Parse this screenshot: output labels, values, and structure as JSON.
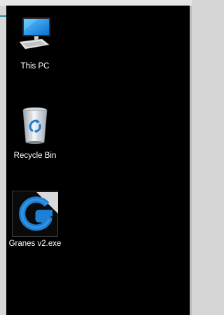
{
  "desktop": {
    "icons": [
      {
        "label": "This PC",
        "icon": "computer-monitor-icon"
      },
      {
        "label": "Recycle Bin",
        "icon": "recycle-bin-icon"
      },
      {
        "label": "Granes v2.exe",
        "icon": "app-g-logo-icon"
      }
    ]
  },
  "colors": {
    "desktop_background": "#000000",
    "frame": "#d6d6d6",
    "accent": "#2a8c8c",
    "icon_blue": "#1e7fd6"
  }
}
